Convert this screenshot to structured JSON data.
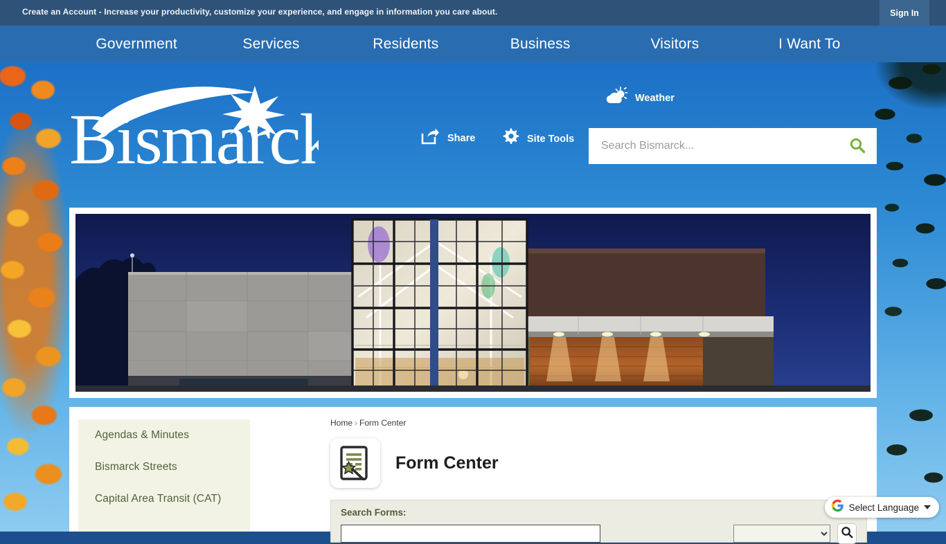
{
  "top_bar": {
    "message": "Create an Account - Increase your productivity, customize your experience, and engage in information you care about.",
    "sign_in_label": "Sign In"
  },
  "nav": {
    "items": [
      {
        "label": "Government"
      },
      {
        "label": "Services"
      },
      {
        "label": "Residents"
      },
      {
        "label": "Business"
      },
      {
        "label": "Visitors"
      },
      {
        "label": "I Want To"
      }
    ]
  },
  "header": {
    "logo_text": "Bismarck",
    "weather_label": "Weather",
    "share_label": "Share",
    "site_tools_label": "Site Tools",
    "search_placeholder": "Search Bismarck...",
    "search_value": "",
    "icons": {
      "weather": "cloud-sun-icon",
      "share": "share-icon",
      "site_tools": "gear-icon",
      "search": "magnifier-icon"
    }
  },
  "sidebar": {
    "items": [
      {
        "label": "Agendas & Minutes"
      },
      {
        "label": "Bismarck Streets"
      },
      {
        "label": "Capital Area Transit (CAT)"
      }
    ]
  },
  "main": {
    "breadcrumb": {
      "home": "Home",
      "separator": "›",
      "current": "Form Center"
    },
    "page_title": "Form Center",
    "page_icon": "form-wand-icon",
    "forms": {
      "label": "Search Forms:",
      "search_value": "",
      "search_placeholder": "",
      "category_value": "",
      "search_button_icon": "magnifier-icon"
    }
  },
  "translate": {
    "label": "Select Language",
    "icon": "google-g-icon",
    "chevron": "chevron-down-icon"
  },
  "colors": {
    "top_bar": "#2f5278",
    "nav_bar": "#2a6cb0",
    "sky": "#2e8bd4",
    "search_green": "#7cb342",
    "sidebar_bg": "#f2f3e4",
    "sidebar_text": "#52603c",
    "forms_panel_bg": "#ecece2"
  }
}
